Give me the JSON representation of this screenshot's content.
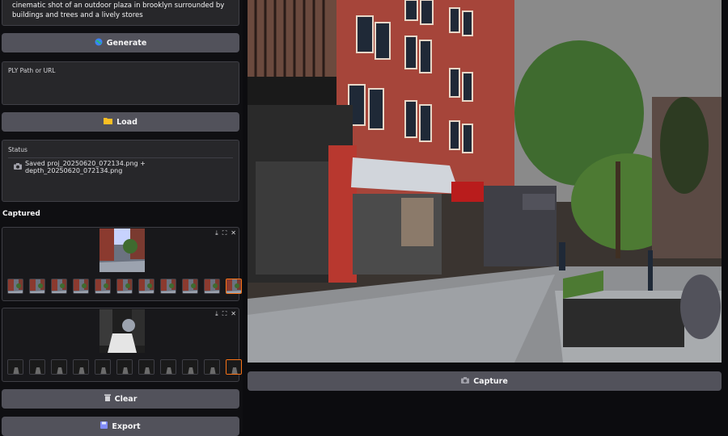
{
  "prompt": {
    "text": "cinematic shot of an outdoor plaza in brooklyn  surrounded by buildings and trees and a lively stores"
  },
  "buttons": {
    "generate": "Generate",
    "load": "Load",
    "clear": "Clear",
    "export": "Export",
    "capture": "Capture"
  },
  "ply": {
    "label": "PLY Path or URL",
    "value": ""
  },
  "status": {
    "label": "Status",
    "text": "Saved proj_20250620_072134.png + depth_20250620_072134.png"
  },
  "captured": {
    "title": "Captured",
    "rgb_thumb_count": 11,
    "depth_thumb_count": 11
  },
  "colors": {
    "button_bg": "#52525b",
    "panel_bg": "#27272a",
    "selected_border": "#f97316"
  }
}
